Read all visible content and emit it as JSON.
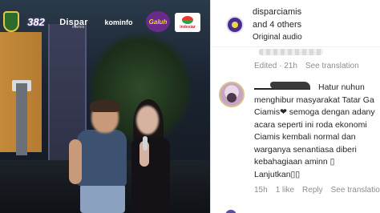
{
  "video": {
    "logos": {
      "dispar": "Dispar",
      "dispar_sub": "ciamis",
      "kominfo": "kominfo",
      "galuh": "Galuh",
      "indosiar": "indosiar",
      "anniversary": "382"
    }
  },
  "post": {
    "header": {
      "username": "disparciamis",
      "collaborators": "and 4 others",
      "audio": "Original audio"
    },
    "caption_meta": {
      "time": "Edited · 21h",
      "see_translation": "See translation"
    },
    "comment": {
      "lines": [
        "Hatur nuhun",
        "menghibur masyarakat Tatar Ga",
        "Ciamis❤ semoga dengan adany",
        "acara seperti ini roda ekonomi ",
        "Ciamis kembali normal dan",
        "warganya senantiasa diberi",
        "kebahagiaan aminn ▯",
        "Lanjutkan▯▯"
      ],
      "time": "15h",
      "likes": "1 like",
      "reply": "Reply",
      "see_translation": "See translatio"
    }
  }
}
